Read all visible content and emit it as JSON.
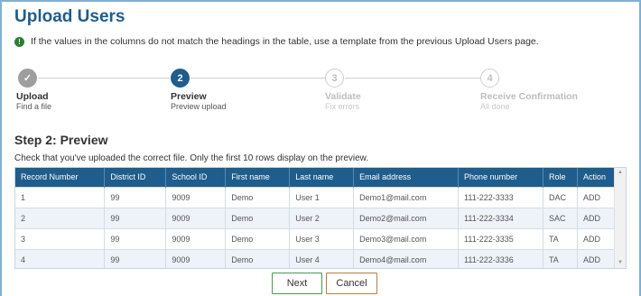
{
  "page": {
    "title": "Upload Users",
    "info_message": "If the values in the columns do not match the headings in the table, use a template from the previous Upload Users page.",
    "info_icon_glyph": "!"
  },
  "stepper": {
    "steps": [
      {
        "number": "✓",
        "label": "Upload",
        "sublabel": "Find a file",
        "state": "done"
      },
      {
        "number": "2",
        "label": "Preview",
        "sublabel": "Preview upload",
        "state": "active"
      },
      {
        "number": "3",
        "label": "Validate",
        "sublabel": "Fix errors",
        "state": "todo"
      },
      {
        "number": "4",
        "label": "Receive Confirmation",
        "sublabel": "All done",
        "state": "todo"
      }
    ]
  },
  "preview": {
    "heading": "Step 2: Preview",
    "description": "Check that you've uploaded the correct file. Only the first 10 rows display on the preview.",
    "columns": [
      "Record Number",
      "District ID",
      "School ID",
      "First name",
      "Last name",
      "Email address",
      "Phone number",
      "Role",
      "Action"
    ],
    "rows": [
      [
        "1",
        "99",
        "9009",
        "Demo",
        "User 1",
        "Demo1@mail.com",
        "111-222-3333",
        "DAC",
        "ADD"
      ],
      [
        "2",
        "99",
        "9009",
        "Demo",
        "User 2",
        "Demo2@mail.com",
        "111-222-3334",
        "SAC",
        "ADD"
      ],
      [
        "3",
        "99",
        "9009",
        "Demo",
        "User 3",
        "Demo3@mail.com",
        "111-222-3335",
        "TA",
        "ADD"
      ],
      [
        "4",
        "99",
        "9009",
        "Demo",
        "User 4",
        "Demo4@mail.com",
        "111-222-3336",
        "TA",
        "ADD"
      ]
    ]
  },
  "buttons": {
    "next": "Next",
    "cancel": "Cancel"
  },
  "icons": {
    "info": "info-icon",
    "check": "checkmark-icon",
    "scroll_up": "scroll-up-arrow-icon",
    "scroll_down": "scroll-down-arrow-icon"
  },
  "colors": {
    "brand": "#1f5d8c",
    "info_green": "#2e7d32",
    "next_border": "#4a9a4e",
    "cancel_border": "#c07a3a"
  }
}
